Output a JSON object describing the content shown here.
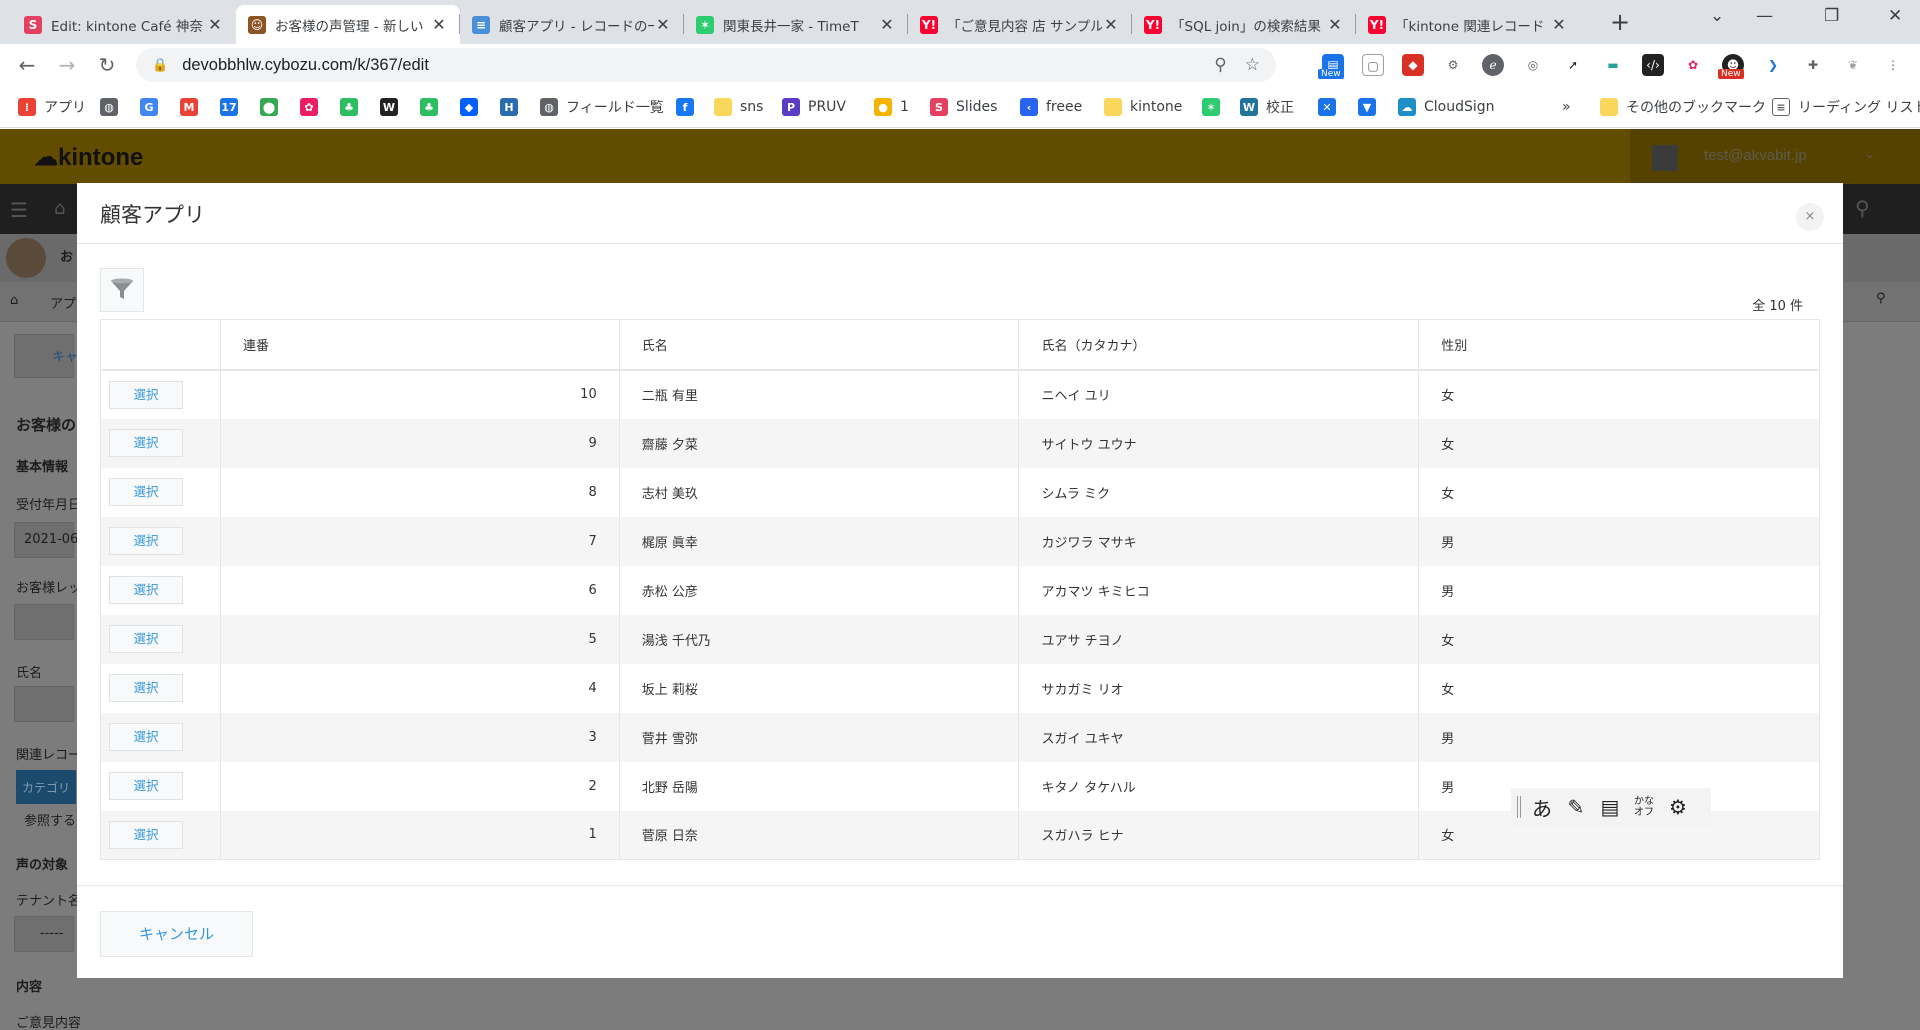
{
  "browser": {
    "tabs": [
      {
        "title": "Edit: kintone Café 神奈",
        "favicon": "S",
        "favicon_color": "#e4405f"
      },
      {
        "title": "お客様の声管理 - 新しい",
        "favicon": "☺",
        "favicon_color": "#8d5524"
      },
      {
        "title": "顧客アプリ - レコードの一",
        "favicon": "≡",
        "favicon_color": "#4a90d9"
      },
      {
        "title": "関東長井一家 - TimeT",
        "favicon": "✶",
        "favicon_color": "#2ecc71"
      },
      {
        "title": "「ご意見内容 店 サンプル",
        "favicon": "Y!",
        "favicon_color": "#ff0033"
      },
      {
        "title": "「SQL join」の検索結果",
        "favicon": "Y!",
        "favicon_color": "#ff0033"
      },
      {
        "title": "「kintone 関連レコード",
        "favicon": "Y!",
        "favicon_color": "#ff0033"
      }
    ],
    "url": "devobbhlw.cybozu.com/k/367/edit",
    "bookmarks": [
      {
        "label": "アプリ",
        "icon": "apps-grid-icon",
        "color": "#ea4335"
      },
      {
        "label": "",
        "icon": "globe-icon",
        "color": "#5f6368"
      },
      {
        "label": "",
        "icon": "google-icon",
        "color": "#4285f4"
      },
      {
        "label": "",
        "icon": "gmail-icon",
        "color": "#ea4335"
      },
      {
        "label": "",
        "icon": "calendar-icon",
        "color": "#1a73e8"
      },
      {
        "label": "",
        "icon": "maps-icon",
        "color": "#34a853"
      },
      {
        "label": "",
        "icon": "flower-icon",
        "color": "#e91e63"
      },
      {
        "label": "",
        "icon": "evernote-icon",
        "color": "#2dbe60"
      },
      {
        "label": "",
        "icon": "wikipedia-icon",
        "color": "#222222"
      },
      {
        "label": "",
        "icon": "evernote-icon",
        "color": "#2dbe60"
      },
      {
        "label": "",
        "icon": "dropbox-icon",
        "color": "#0061ff"
      },
      {
        "label": "",
        "icon": "hatena-icon",
        "color": "#2b6cb0"
      },
      {
        "label": "フィールド一覧",
        "icon": "globe-icon",
        "color": "#5f6368"
      },
      {
        "label": "",
        "icon": "facebook-icon",
        "color": "#1877f2"
      },
      {
        "label": "sns",
        "icon": "folder-icon",
        "color": "#f9d65c"
      },
      {
        "label": "PRUV",
        "icon": "pruv-icon",
        "color": "#5b3cc4"
      },
      {
        "label": "1",
        "icon": "badge-icon",
        "color": "#f4b400"
      },
      {
        "label": "Slides",
        "icon": "slides-icon",
        "color": "#e4405f"
      },
      {
        "label": "freee",
        "icon": "freee-icon",
        "color": "#2864f0"
      },
      {
        "label": "kintone",
        "icon": "folder-icon",
        "color": "#f9d65c"
      },
      {
        "label": "",
        "icon": "star-burst-icon",
        "color": "#2ecc71"
      },
      {
        "label": "校正",
        "icon": "wordpress-icon",
        "color": "#21759b"
      },
      {
        "label": "",
        "icon": "pinwheel-icon",
        "color": "#1a73e8"
      },
      {
        "label": "",
        "icon": "pocket-icon",
        "color": "#1a73e8"
      },
      {
        "label": "CloudSign",
        "icon": "cloudsign-icon",
        "color": "#1f8fc8"
      }
    ],
    "bookmarks_more": "»",
    "other_bookmarks": "その他のブックマーク",
    "reading_list": "リーディング リスト"
  },
  "kintone": {
    "logo": "kintone",
    "user_email": "test@akvabit.jp",
    "left_fragments": {
      "title": "お客様の",
      "basic_info": "基本情報",
      "received_date": "受付年月日",
      "date_value": "2021-06",
      "customer_level": "お客様レッ",
      "name_label": "氏名",
      "related_record": "関連レコー",
      "category": "カテゴリ",
      "reference": "参照する",
      "voice_target": "声の対象",
      "tenant": "テナント名",
      "dashes": "-----",
      "content": "内容",
      "opinion": "ご意見内容",
      "header_initial": "お",
      "breadcrumb": "アプ",
      "cancel_fragment": "キャ"
    }
  },
  "modal": {
    "title": "顧客アプリ",
    "close": "×",
    "count": "全 10 件",
    "columns": [
      "",
      "連番",
      "氏名",
      "氏名（カタカナ）",
      "性別"
    ],
    "select_label": "選択",
    "rows": [
      {
        "no": "10",
        "name": "二瓶 有里",
        "kana": "ニヘイ ユリ",
        "gender": "女"
      },
      {
        "no": "9",
        "name": "齋藤 夕菜",
        "kana": "サイトウ ユウナ",
        "gender": "女"
      },
      {
        "no": "8",
        "name": "志村 美玖",
        "kana": "シムラ ミク",
        "gender": "女"
      },
      {
        "no": "7",
        "name": "梶原 眞幸",
        "kana": "カジワラ マサキ",
        "gender": "男"
      },
      {
        "no": "6",
        "name": "赤松 公彦",
        "kana": "アカマツ キミヒコ",
        "gender": "男"
      },
      {
        "no": "5",
        "name": "湯浅 千代乃",
        "kana": "ユアサ チヨノ",
        "gender": "女"
      },
      {
        "no": "4",
        "name": "坂上 莉桜",
        "kana": "サカガミ リオ",
        "gender": "女"
      },
      {
        "no": "3",
        "name": "菅井 雪弥",
        "kana": "スガイ ユキヤ",
        "gender": "男"
      },
      {
        "no": "2",
        "name": "北野 岳陽",
        "kana": "キタノ タケハル",
        "gender": "男"
      },
      {
        "no": "1",
        "name": "菅原 日奈",
        "kana": "スガハラ ヒナ",
        "gender": "女"
      }
    ],
    "cancel_label": "キャンセル"
  },
  "ime": {
    "mode": "あ",
    "kana_line1": "かな",
    "kana_line2": "オフ"
  },
  "colors": {
    "kintone_header": "#614c00",
    "link_blue": "#3498db",
    "overlay_gray": "#7c7c7c"
  }
}
